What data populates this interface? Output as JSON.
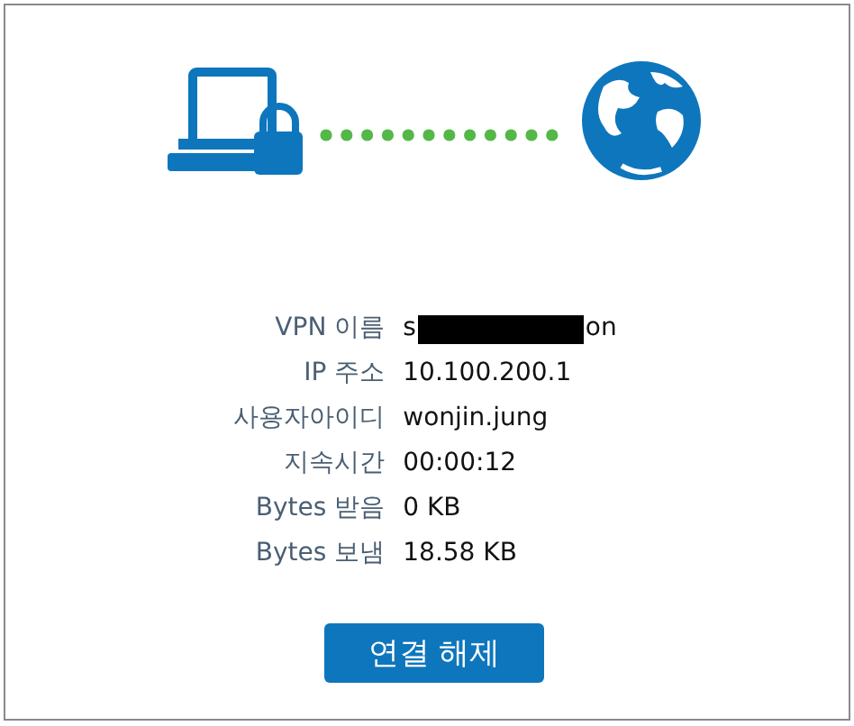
{
  "details": [
    {
      "label": "VPN 이름",
      "value_start": "s",
      "value_end": "on",
      "redacted": true
    },
    {
      "label": "IP 주소",
      "value_start": "10.100.200.1",
      "redacted": false
    },
    {
      "label": "사용자아이디",
      "value_start": "wonjin.jung",
      "redacted": false
    },
    {
      "label": "지속시간",
      "value_start": "00:00:12",
      "redacted": false
    },
    {
      "label": "Bytes 받음",
      "value_start": "0 KB",
      "redacted": false
    },
    {
      "label": "Bytes 보냄",
      "value_start": "18.58 KB",
      "redacted": false
    }
  ],
  "disconnect_button": {
    "label": "연결 해제"
  }
}
